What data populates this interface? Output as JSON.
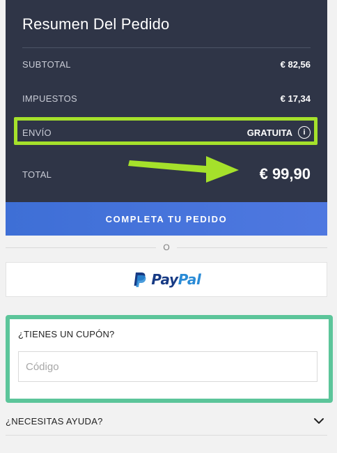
{
  "summary": {
    "title": "Resumen Del Pedido",
    "rows": {
      "subtotal": {
        "label": "SUBTOTAL",
        "value": "€ 82,56"
      },
      "taxes": {
        "label": "IMPUESTOS",
        "value": "€ 17,34"
      },
      "shipping": {
        "label": "ENVÍO",
        "value": "GRATUITA"
      },
      "total": {
        "label": "TOTAL",
        "value": "€ 99,90"
      }
    }
  },
  "cta": {
    "label": "COMPLETA TU PEDIDO"
  },
  "separator": {
    "text": "O"
  },
  "paypal": {
    "pay": "Pay",
    "pal": "Pal"
  },
  "coupon": {
    "title": "¿TIENES UN CUPÓN?",
    "placeholder": "Código",
    "value": ""
  },
  "help": {
    "label": "¿NECESITAS AYUDA?"
  },
  "icons": {
    "info": "info-icon",
    "chevron": "chevron-down-icon",
    "paypal_mark": "paypal-logo-icon",
    "arrow": "arrow-right-icon"
  },
  "colors": {
    "panel": "#2f3547",
    "cta": "#4a74dc",
    "highlight_shipping": "#a5e12b",
    "highlight_coupon": "#5cc59a",
    "paypal_dark": "#173a84",
    "paypal_light": "#2a8bd6"
  }
}
